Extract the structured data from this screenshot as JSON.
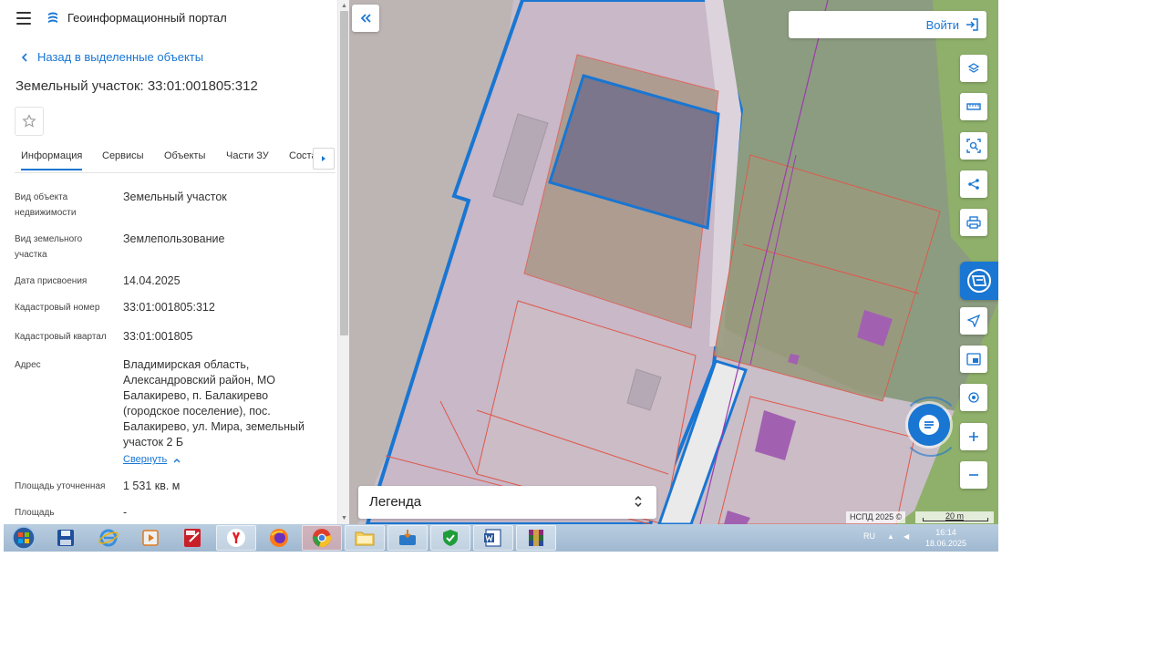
{
  "app": {
    "title": "Геоинформационный портал",
    "back_label": "Назад в выделенные объекты",
    "object_title": "Земельный участок: 33:01:001805:312"
  },
  "tabs": [
    {
      "label": "Информация",
      "active": true
    },
    {
      "label": "Сервисы",
      "active": false
    },
    {
      "label": "Объекты",
      "active": false
    },
    {
      "label": "Части ЗУ",
      "active": false
    },
    {
      "label": "Состав",
      "active": false
    }
  ],
  "properties": [
    {
      "label": "Вид объекта недвижимости",
      "value": "Земельный участок"
    },
    {
      "label": "Вид земельного участка",
      "value": "Землепользование"
    },
    {
      "label": "Дата присвоения",
      "value": "14.04.2025"
    },
    {
      "label": "Кадастровый номер",
      "value": "33:01:001805:312"
    },
    {
      "label": "Кадастровый квартал",
      "value": "33:01:001805"
    },
    {
      "label": "Адрес",
      "value": "Владимирская область, Александровский район, МО Балакирево, п. Балакирево (городское поселение), пос. Балакирево, ул. Мира, земельный участок 2 Б"
    },
    {
      "label": "Площадь уточненная",
      "value": "1 531 кв. м"
    },
    {
      "label": "Площадь",
      "value": "-"
    }
  ],
  "collapse_label": "Свернуть",
  "map": {
    "login_label": "Войти",
    "legend_label": "Легенда",
    "attribution": "НСПД 2025 ©",
    "scale_label": "20 m",
    "tools": [
      "layers-icon",
      "ruler-icon",
      "area-select-icon",
      "share-icon",
      "print-icon",
      "nspd-icon",
      "navigate-icon",
      "minimap-icon",
      "geolocate-icon",
      "zoom-in-icon",
      "zoom-out-icon"
    ]
  },
  "taskbar": {
    "items": [
      "start-icon",
      "save-icon",
      "internet-explorer-icon",
      "media-player-icon",
      "pdf-editor-icon",
      "yandex-browser-icon",
      "firefox-icon",
      "chrome-icon",
      "file-explorer-icon",
      "etp-icon",
      "security-shield-icon",
      "word-icon",
      "winrar-icon"
    ],
    "language": "RU",
    "time": "16:14",
    "date": "18.06.2025"
  },
  "colors": {
    "accent": "#1976d2",
    "selected_parcel": "#1976d2",
    "parcel_fill": "#c9bcc9",
    "green_area": "#8fb06a"
  }
}
